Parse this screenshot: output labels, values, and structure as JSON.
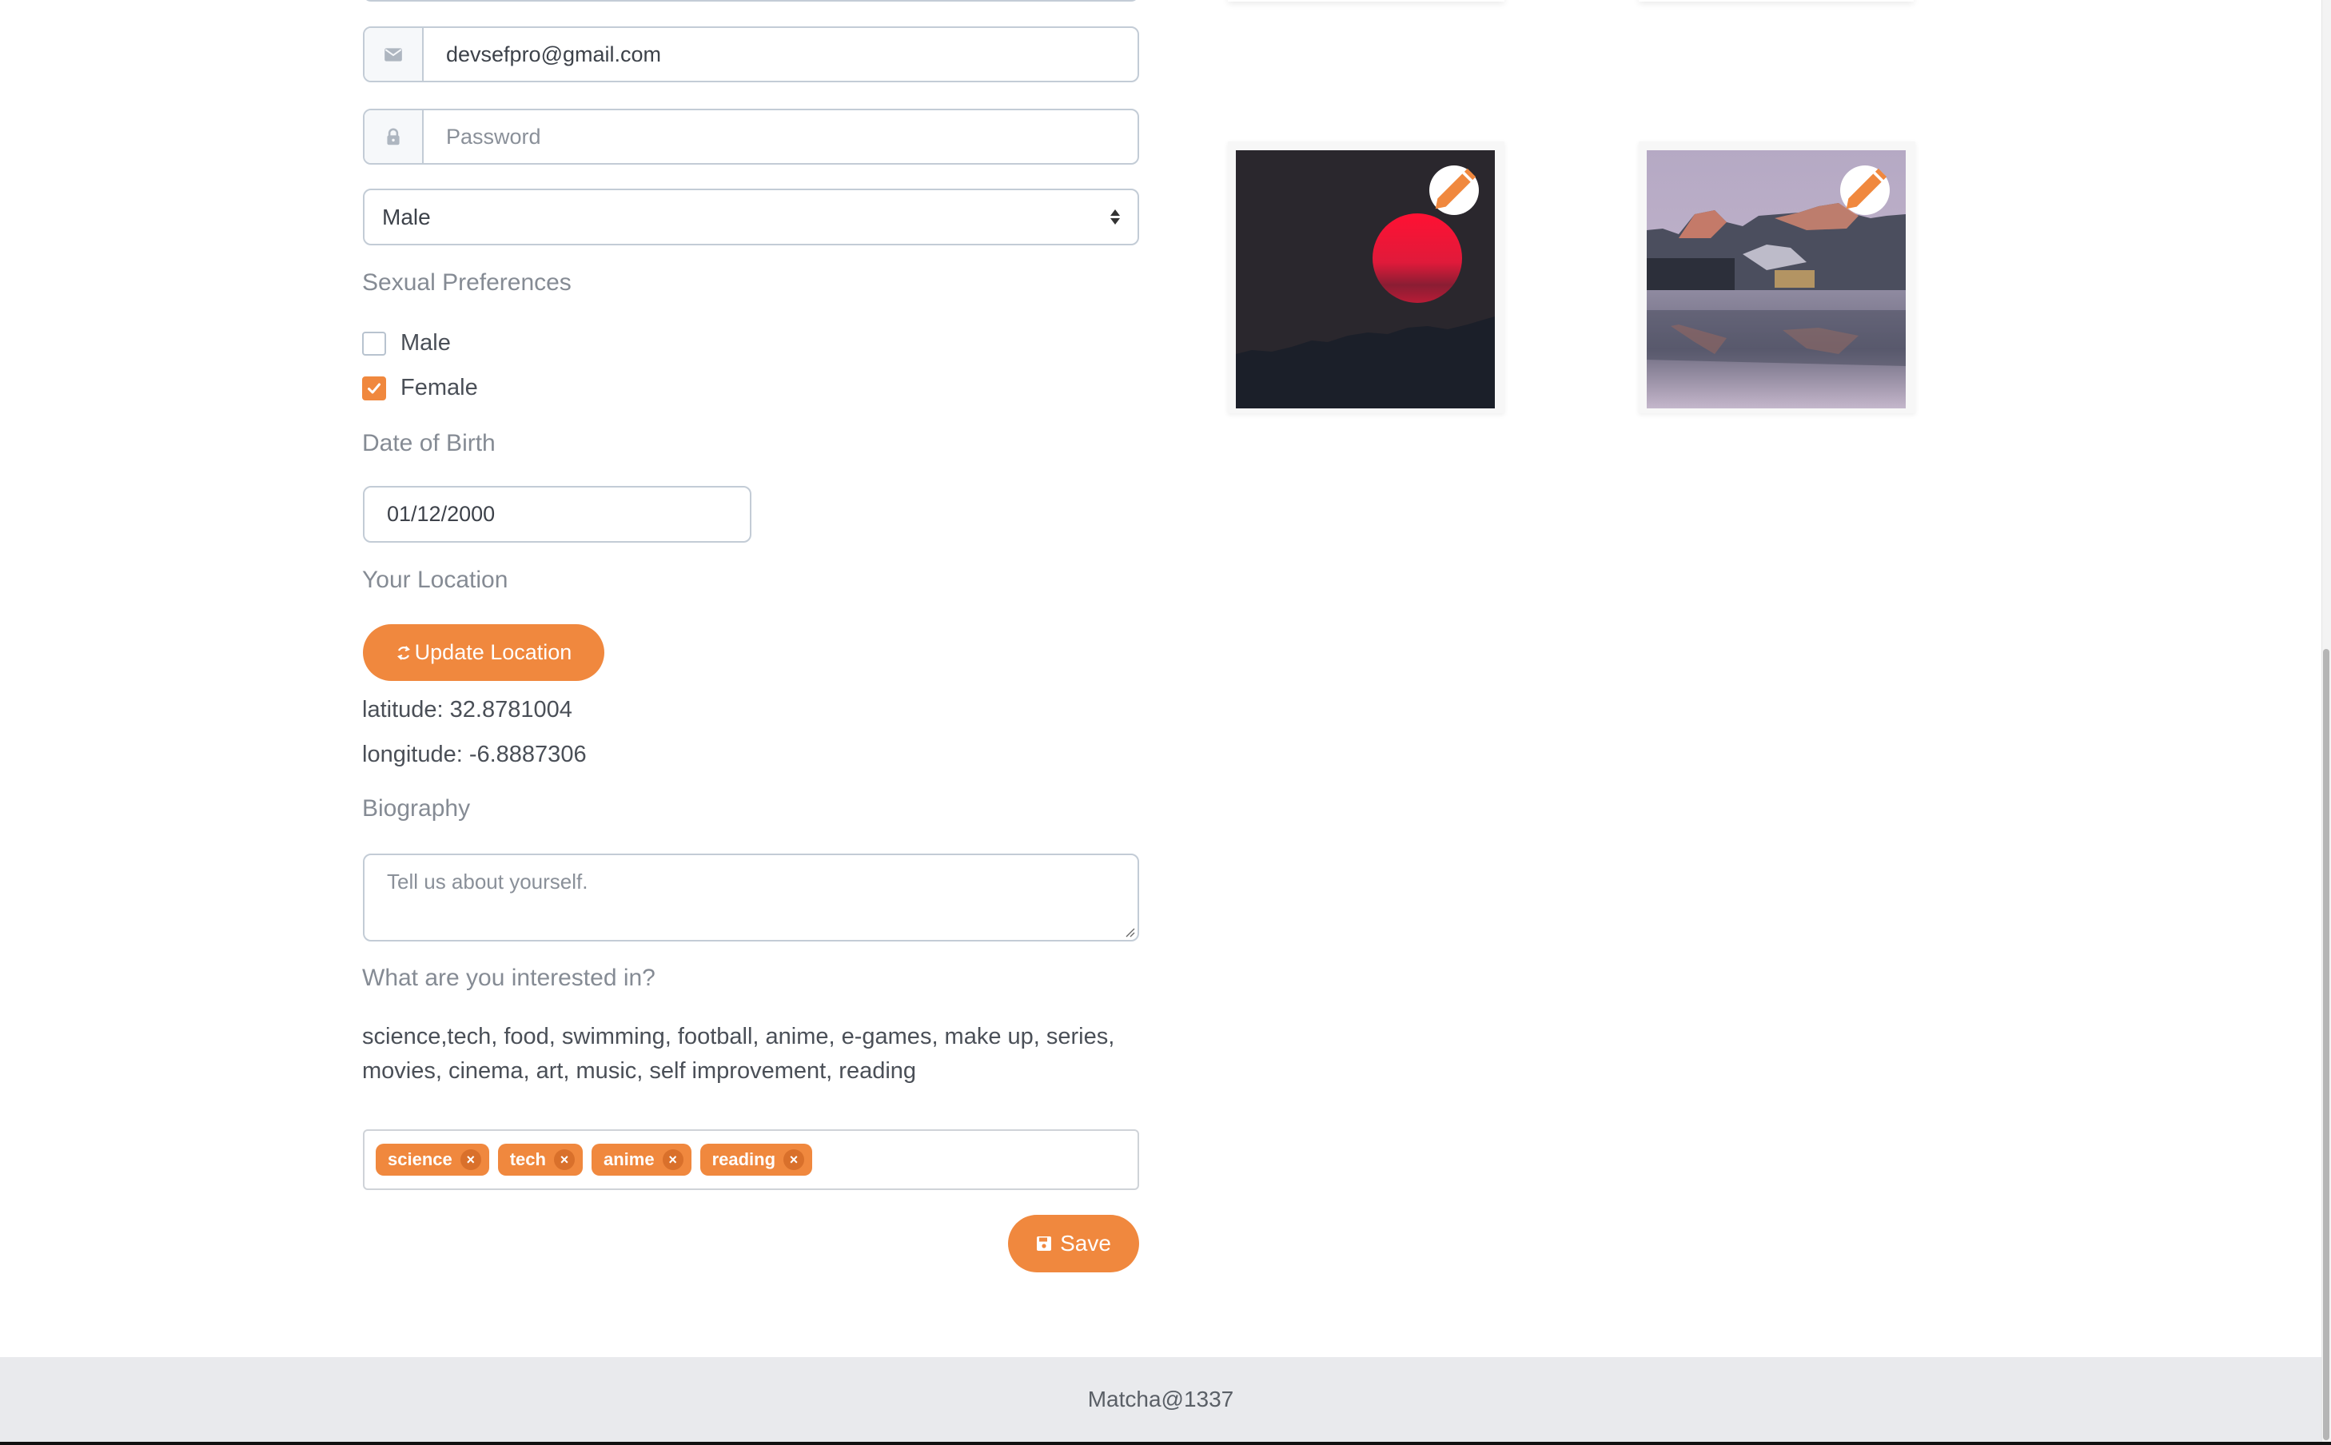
{
  "form": {
    "email": {
      "value": "devsefpro@gmail.com",
      "icon": "envelope-icon"
    },
    "password": {
      "value": "",
      "placeholder": "Password",
      "icon": "lock-icon"
    },
    "gender_select": {
      "selected": "Male"
    },
    "sexual_preferences": {
      "label": "Sexual Preferences",
      "options": [
        {
          "label": "Male",
          "checked": false
        },
        {
          "label": "Female",
          "checked": true
        }
      ]
    },
    "date_of_birth": {
      "label": "Date of Birth",
      "value": "01/12/2000"
    },
    "location": {
      "label": "Your Location",
      "update_button": "Update Location",
      "latitude_text": "latitude: 32.8781004",
      "longitude_text": "longitude: -6.8887306"
    },
    "biography": {
      "label": "Biography",
      "value": "",
      "placeholder": "Tell us about yourself."
    },
    "interests": {
      "label": "What are you interested in?",
      "available_text": "science,tech, food, swimming, football, anime, e-games, make up, series, movies, cinema, art, music, self improvement, reading",
      "selected_tags": [
        "science",
        "tech",
        "anime",
        "reading"
      ],
      "remove_glyph": "×"
    },
    "save_button": "Save"
  },
  "photos": [
    {
      "description": "red sun setting over dark forest silhouette",
      "edit_icon": "pencil-icon"
    },
    {
      "description": "mountain range reflected in lake at dusk",
      "edit_icon": "pencil-icon"
    }
  ],
  "footer": {
    "text": "Matcha@1337"
  },
  "colors": {
    "accent": "#f0883e",
    "footer_bg": "#e9eaed",
    "border": "#c3ccd6",
    "label": "#858b94"
  }
}
